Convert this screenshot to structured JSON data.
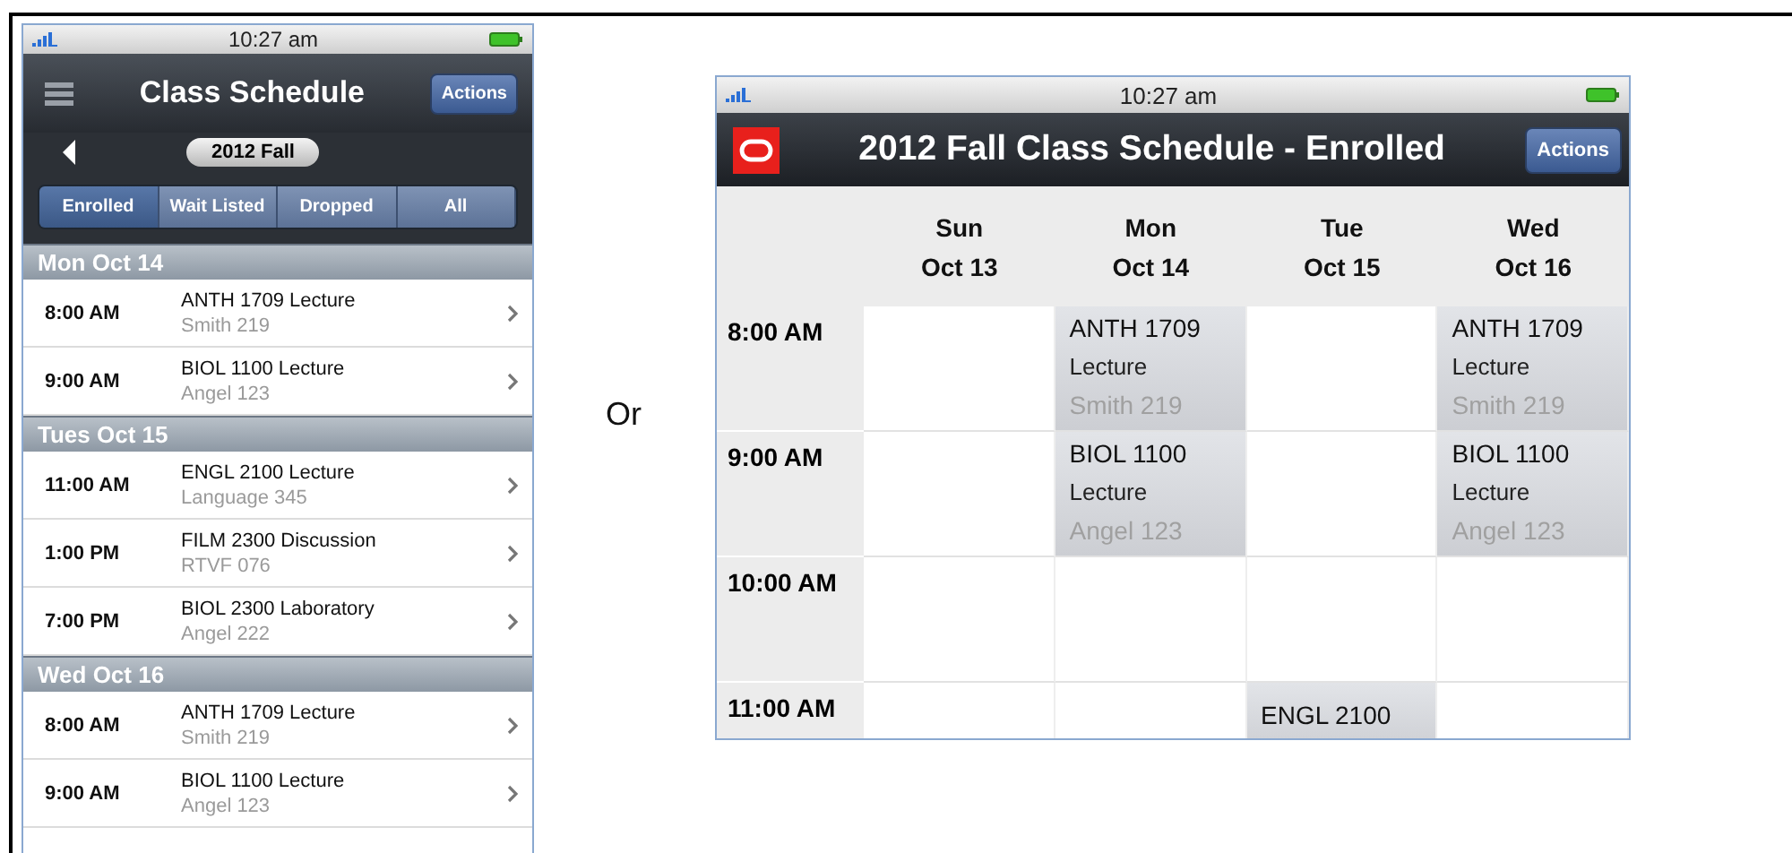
{
  "list_screen": {
    "status_bar": {
      "time": "10:27 am"
    },
    "header": {
      "title": "Class Schedule",
      "action_button": "Actions"
    },
    "term": {
      "label": "2012 Fall"
    },
    "tabs": [
      {
        "label": "Enrolled",
        "selected": true
      },
      {
        "label": "Wait Listed",
        "selected": false
      },
      {
        "label": "Dropped",
        "selected": false
      },
      {
        "label": "All",
        "selected": false
      }
    ],
    "sections": [
      {
        "title": "Mon Oct 14",
        "rows": [
          {
            "time": "8:00 AM",
            "course": "ANTH 1709 Lecture",
            "location": "Smith 219"
          },
          {
            "time": "9:00 AM",
            "course": "BIOL 1100 Lecture",
            "location": "Angel 123"
          }
        ]
      },
      {
        "title": "Tues Oct 15",
        "rows": [
          {
            "time": "11:00 AM",
            "course": "ENGL 2100 Lecture",
            "location": "Language 345"
          },
          {
            "time": "1:00 PM",
            "course": "FILM 2300 Discussion",
            "location": "RTVF 076"
          },
          {
            "time": "7:00 PM",
            "course": "BIOL 2300 Laboratory",
            "location": "Angel 222"
          }
        ]
      },
      {
        "title": "Wed Oct 16",
        "rows": [
          {
            "time": "8:00 AM",
            "course": "ANTH 1709 Lecture",
            "location": "Smith 219"
          },
          {
            "time": "9:00 AM",
            "course": "BIOL 1100 Lecture",
            "location": "Angel 123"
          }
        ]
      }
    ]
  },
  "separator": "Or",
  "calendar_screen": {
    "status_bar": {
      "time": "10:27 am"
    },
    "header": {
      "title": "2012 Fall Class Schedule - Enrolled",
      "action_button": "Actions"
    },
    "days": [
      {
        "day": "Sun",
        "date": "Oct 13"
      },
      {
        "day": "Mon",
        "date": "Oct 14"
      },
      {
        "day": "Tue",
        "date": "Oct 15"
      },
      {
        "day": "Wed",
        "date": "Oct 16"
      }
    ],
    "time_slots": [
      {
        "time": "8:00 AM",
        "cells": [
          {
            "kind": "empty"
          },
          {
            "kind": "event",
            "course": "ANTH 1709",
            "type": "Lecture",
            "location": "Smith 219"
          },
          {
            "kind": "empty"
          },
          {
            "kind": "event",
            "course": "ANTH 1709",
            "type": "Lecture",
            "location": "Smith 219"
          }
        ]
      },
      {
        "time": "9:00 AM",
        "cells": [
          {
            "kind": "empty"
          },
          {
            "kind": "event",
            "course": "BIOL 1100",
            "type": "Lecture",
            "location": "Angel 123"
          },
          {
            "kind": "empty"
          },
          {
            "kind": "event",
            "course": "BIOL 1100",
            "type": "Lecture",
            "location": "Angel 123"
          }
        ]
      },
      {
        "time": "10:00 AM",
        "cells": [
          {
            "kind": "empty"
          },
          {
            "kind": "empty"
          },
          {
            "kind": "empty"
          },
          {
            "kind": "empty"
          }
        ]
      },
      {
        "time": "11:00 AM",
        "cells": [
          {
            "kind": "empty"
          },
          {
            "kind": "empty"
          },
          {
            "kind": "event",
            "course": "ENGL 2100"
          },
          {
            "kind": "empty"
          }
        ]
      }
    ]
  }
}
